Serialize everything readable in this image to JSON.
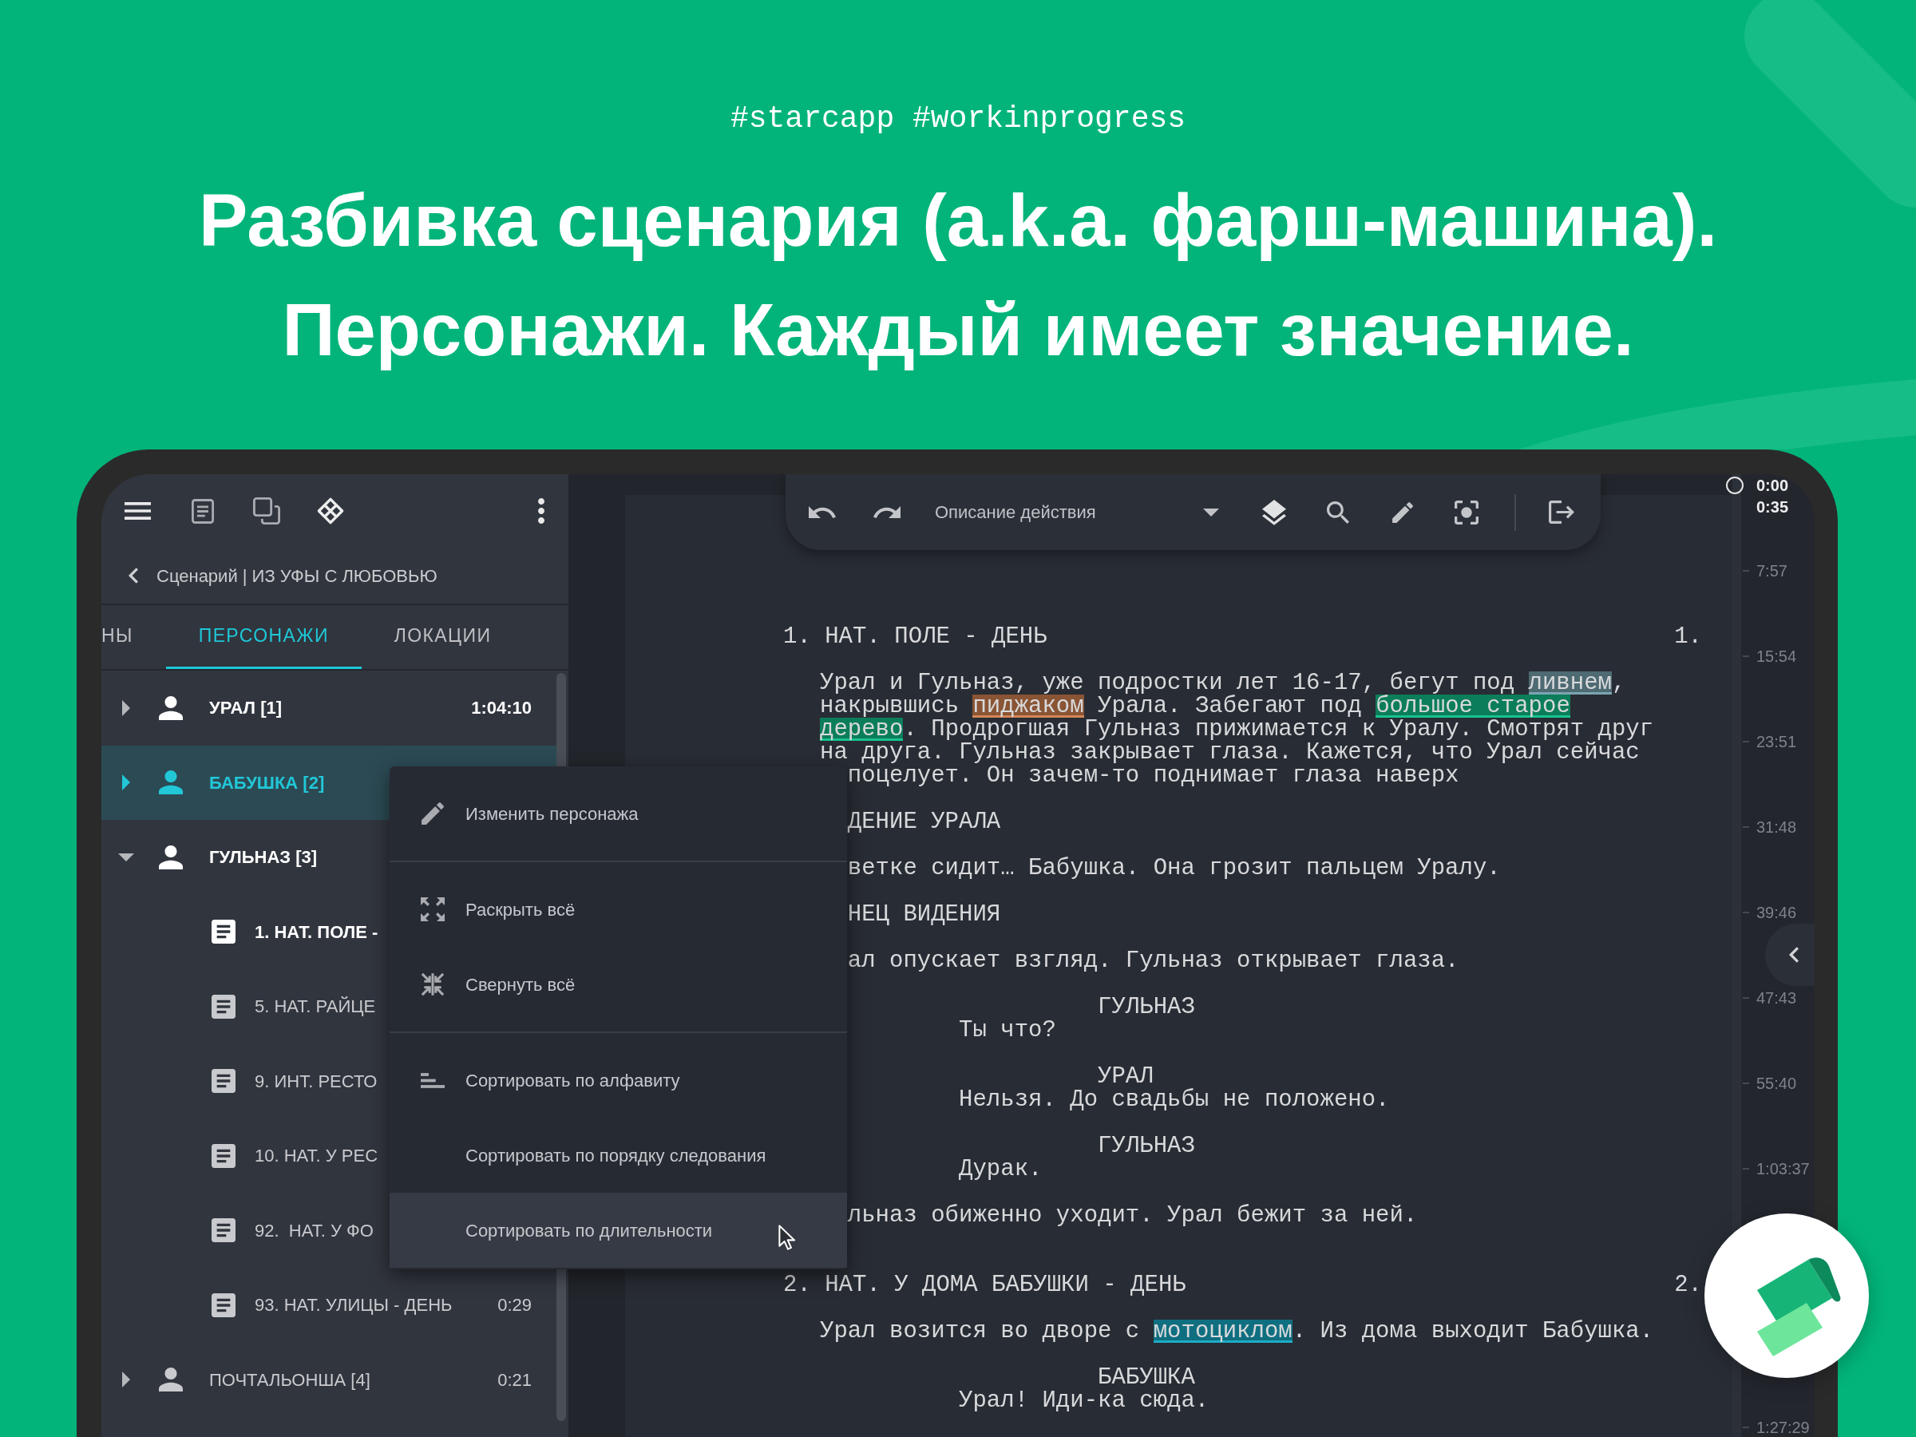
{
  "hashtags": "#starcapp #workinprogress",
  "headline": [
    "Разбивка сценария (a.k.a. фарш-машина).",
    "Персонажи. Каждый имеет значение."
  ],
  "sidebar": {
    "breadcrumb": "Сценарий | ИЗ УФЫ С ЛЮБОВЬЮ",
    "tabs": [
      {
        "label": "НЫ",
        "selected": false
      },
      {
        "label": "ПЕРСОНАЖИ",
        "selected": true
      },
      {
        "label": "ЛОКАЦИИ",
        "selected": false
      }
    ],
    "characters": [
      {
        "name": "УРАЛ [1]",
        "time": "1:04:10",
        "expanded": false,
        "selected": false,
        "current": true
      },
      {
        "name": "БАБУШКА [2]",
        "expanded": false,
        "selected": true,
        "current": true
      },
      {
        "name": "ГУЛЬНАЗ [3]",
        "expanded": true,
        "selected": false,
        "current": true,
        "children": [
          {
            "title": "1. НАТ. ПОЛЕ -",
            "current": true,
            "selected": false
          },
          {
            "title": "5. НАТ. РАЙЦЕ",
            "current": false,
            "selected": false
          },
          {
            "title": "9. ИНТ. РЕСТО",
            "current": false,
            "selected": false
          },
          {
            "title": "10. НАТ. У РЕС",
            "current": false,
            "selected": false
          },
          {
            "title": "92.  НАТ. У ФО",
            "current": false,
            "selected": false
          },
          {
            "title": "93. НАТ. УЛИЦЫ - ДЕНЬ",
            "time": "0:29",
            "current": false,
            "selected": false
          }
        ]
      },
      {
        "name": "ПОЧТАЛЬОНША [4]",
        "time": "0:21",
        "expanded": false,
        "selected": false,
        "current": false
      }
    ]
  },
  "toolbar": {
    "paragraph_type": "Описание действия"
  },
  "context_menu": [
    {
      "kind": "item",
      "label": "Изменить персонажа",
      "hovered": false
    },
    {
      "kind": "divider"
    },
    {
      "kind": "item",
      "label": "Раскрыть всё",
      "hovered": false
    },
    {
      "kind": "item",
      "label": "Свернуть всё",
      "hovered": false
    },
    {
      "kind": "divider"
    },
    {
      "kind": "item",
      "label": "Сортировать по алфавиту",
      "hovered": false
    },
    {
      "kind": "item",
      "label": "Сортировать по порядку следования",
      "hovered": false
    },
    {
      "kind": "item",
      "label": "Сортировать по длительности",
      "hovered": true
    }
  ],
  "script": [
    {
      "kind": "scene_heading",
      "text": "1. НАТ. ПОЛЕ - ДЕНЬ",
      "number": "1."
    },
    {
      "kind": "action",
      "lines": [
        {
          "clipped": false,
          "segments": [
            {
              "text": "Урал и Гульназ, уже подростки лет 16-17, бегут под "
            },
            {
              "text": "ливнем",
              "color": "#4e6a72"
            },
            {
              "text": ","
            }
          ]
        },
        {
          "clipped": false,
          "segments": [
            {
              "text": "накрывшись "
            },
            {
              "text": "пиджаком",
              "color": "#8a5535"
            },
            {
              "text": " Урала. Забегают под "
            },
            {
              "text": "большое старое",
              "color": "#0c7d5a"
            }
          ]
        },
        {
          "clipped": false,
          "segments": [
            {
              "text": "дерево",
              "color": "#0c7d5a"
            },
            {
              "text": ". Продрогшая Гульназ прижимается к Уралу. Смотрят друг"
            }
          ]
        },
        {
          "clipped": false,
          "segments": [
            {
              "text": "на друга. Гульназ закрывает глаза. Кажется, что Урал сейчас"
            }
          ]
        },
        {
          "clipped": true,
          "segments": [
            {
              "text": "поцелует. Он зачем-то поднимает глаза наверх"
            }
          ]
        }
      ]
    },
    {
      "kind": "action",
      "lines": [
        {
          "clipped": true,
          "segments": [
            {
              "text": "ДЕНИЕ УРАЛА"
            }
          ]
        }
      ]
    },
    {
      "kind": "action",
      "lines": [
        {
          "clipped": true,
          "segments": [
            {
              "text": "ветке сидит… Бабушка. Она грозит пальцем Уралу."
            }
          ]
        }
      ]
    },
    {
      "kind": "action",
      "lines": [
        {
          "clipped": true,
          "segments": [
            {
              "text": "НЕЦ ВИДЕНИЯ"
            }
          ]
        }
      ]
    },
    {
      "kind": "action",
      "lines": [
        {
          "clipped": true,
          "segments": [
            {
              "text": "ал опускает взгляд. Гульназ открывает глаза."
            }
          ]
        }
      ]
    },
    {
      "kind": "character",
      "text": "ГУЛЬНАЗ"
    },
    {
      "kind": "dialogue",
      "text": "Ты что?"
    },
    {
      "kind": "character",
      "text": "УРАЛ"
    },
    {
      "kind": "dialogue",
      "text": "Нельзя. До свадьбы не положено."
    },
    {
      "kind": "character",
      "text": "ГУЛЬНАЗ"
    },
    {
      "kind": "dialogue",
      "text": "Дурак."
    },
    {
      "kind": "action",
      "lines": [
        {
          "clipped": true,
          "segments": [
            {
              "text": "льназ обиженно уходит. Урал бежит за ней."
            }
          ]
        }
      ]
    },
    {
      "kind": "scene_heading",
      "text": "2. НАТ. У ДОМА БАБУШКИ - ДЕНЬ",
      "number": "2."
    },
    {
      "kind": "action",
      "lines": [
        {
          "clipped": false,
          "segments": [
            {
              "text": "Урал возится во дворе с "
            },
            {
              "text": "мотоциклом",
              "color": "#0f6f80"
            },
            {
              "text": ". Из дома выходит Бабушка."
            }
          ]
        }
      ]
    },
    {
      "kind": "character",
      "text": "БАБУШКА"
    },
    {
      "kind": "dialogue",
      "text": "Урал! Иди-ка сюда."
    }
  ],
  "timeline": {
    "marker_times": [
      "0:00",
      "0:35"
    ],
    "ticks": [
      "7:57",
      "15:54",
      "23:51",
      "31:48",
      "39:46",
      "47:43",
      "55:40",
      "1:03:37",
      "1:27:29"
    ]
  }
}
